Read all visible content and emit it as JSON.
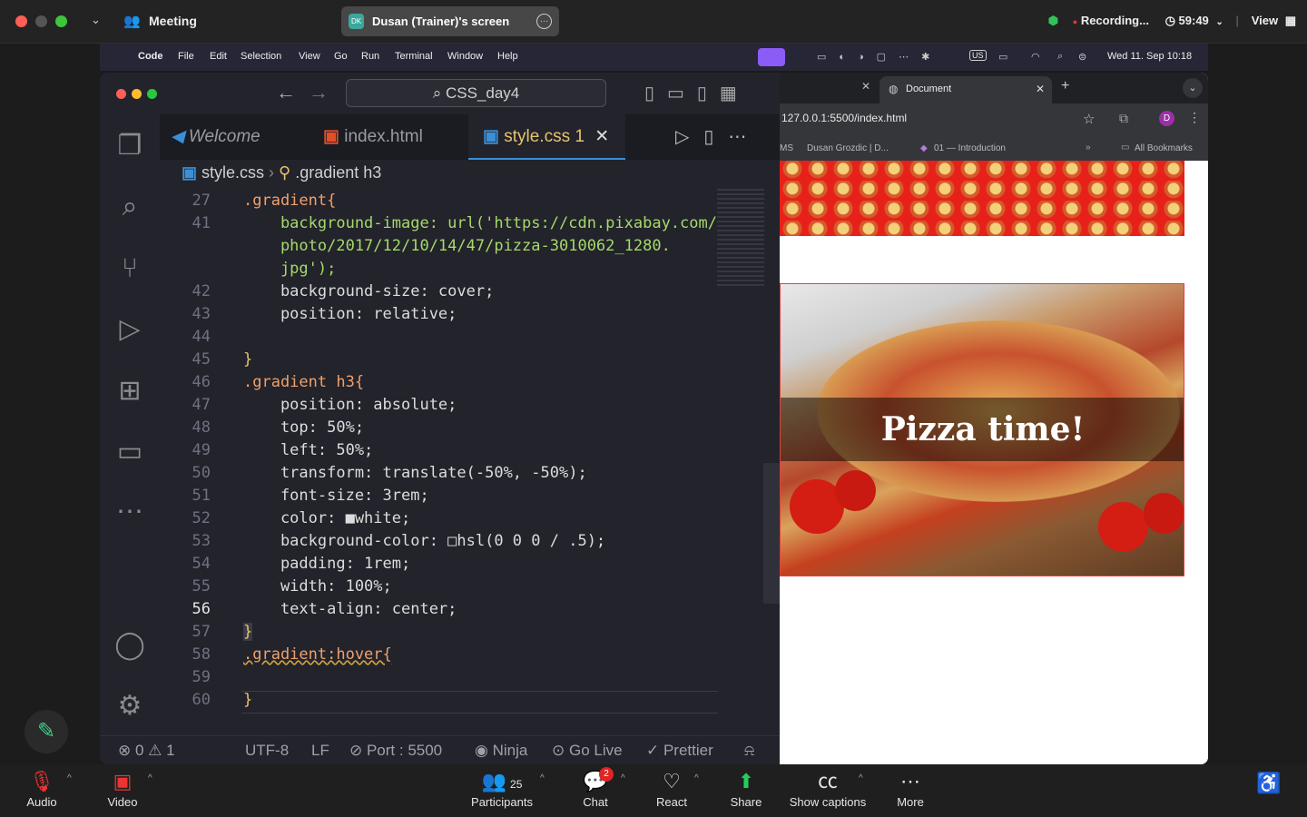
{
  "zoom": {
    "title": "Meeting",
    "share_label": "Dusan (Trainer)'s screen",
    "share_avatar": "DK",
    "recording": "Recording...",
    "timer": "59:49",
    "view": "View",
    "bottom": {
      "audio": "Audio",
      "video": "Video",
      "participants": "Participants",
      "participants_count": "25",
      "chat": "Chat",
      "chat_badge": "2",
      "react": "React",
      "share": "Share",
      "captions": "Show captions",
      "more": "More"
    }
  },
  "macos": {
    "app": "Code",
    "menus": [
      "File",
      "Edit",
      "Selection",
      "View",
      "Go",
      "Run",
      "Terminal",
      "Window",
      "Help"
    ],
    "clock": "Wed 11. Sep  10:18",
    "input": "US"
  },
  "vscode": {
    "search": "CSS_day4",
    "tabs": [
      {
        "label": "Welcome"
      },
      {
        "label": "index.html"
      },
      {
        "label": "style.css",
        "badge": "1"
      }
    ],
    "breadcrumb": {
      "file": "style.css",
      "symbol": ".gradient h3"
    },
    "lines": [
      {
        "n": "27",
        "code": ".gradient{"
      },
      {
        "n": "41",
        "code": "    background-image: url('https://cdn.pixabay.com/"
      },
      {
        "n": "",
        "code": "    photo/2017/12/10/14/47/pizza-3010062_1280."
      },
      {
        "n": "",
        "code": "    jpg');"
      },
      {
        "n": "42",
        "code": "    background-size: cover;"
      },
      {
        "n": "43",
        "code": "    position: relative;"
      },
      {
        "n": "44",
        "code": ""
      },
      {
        "n": "45",
        "code": "}"
      },
      {
        "n": "46",
        "code": ".gradient h3{"
      },
      {
        "n": "47",
        "code": "    position: absolute;"
      },
      {
        "n": "48",
        "code": "    top: 50%;"
      },
      {
        "n": "49",
        "code": "    left: 50%;"
      },
      {
        "n": "50",
        "code": "    transform: translate(-50%, -50%);"
      },
      {
        "n": "51",
        "code": "    font-size: 3rem;"
      },
      {
        "n": "52",
        "code": "    color: ■white;"
      },
      {
        "n": "53",
        "code": "    background-color: □hsl(0 0 0 / .5);"
      },
      {
        "n": "54",
        "code": "    padding: 1rem;"
      },
      {
        "n": "55",
        "code": "    width: 100%;"
      },
      {
        "n": "56",
        "code": "    text-align: center;"
      },
      {
        "n": "57",
        "code": "}"
      },
      {
        "n": "58",
        "code": ".gradient:hover{"
      },
      {
        "n": "59",
        "code": ""
      },
      {
        "n": "60",
        "code": "}"
      }
    ],
    "status": {
      "errors": "0",
      "warnings": "1",
      "encoding": "UTF-8",
      "eol": "LF",
      "port": "Port : 5500",
      "ninja": "Ninja",
      "golive": "Go Live",
      "prettier": "Prettier"
    }
  },
  "browser": {
    "tab": "Document",
    "url": "127.0.0.1:5500/index.html",
    "bookmarks": [
      "MS",
      "Dusan Grozdic | D...",
      "01 — Introduction"
    ],
    "all_bookmarks": "All Bookmarks",
    "profile": "D",
    "hero_text": "Pizza time!"
  }
}
